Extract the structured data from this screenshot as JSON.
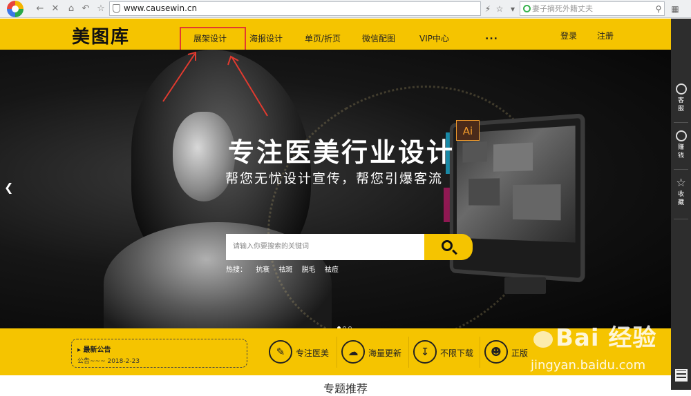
{
  "browser": {
    "url": "www.causewin.cn",
    "search_placeholder": "妻子摘死外籍丈夫"
  },
  "site": {
    "brand": "美图库",
    "nav": [
      {
        "label": "展架设计"
      },
      {
        "label": "海报设计"
      },
      {
        "label": "单页/折页"
      },
      {
        "label": "微信配图"
      },
      {
        "label": "VIP中心"
      }
    ],
    "more": "...",
    "login": "登录",
    "register": "注册"
  },
  "hero": {
    "title": "专注医美行业设计",
    "subtitle": "帮您无忧设计宣传，帮您引爆客流",
    "search_placeholder": "请输入你要搜索的关键词",
    "hot_label": "热搜：",
    "hot_terms": [
      "抗衰",
      "祛斑",
      "脱毛",
      "祛痘"
    ],
    "ai_badge": "Ai",
    "slides_total": 3,
    "slide_active": 1
  },
  "sidebar": {
    "items": [
      {
        "label": "客服",
        "icon": "headset-icon"
      },
      {
        "label": "赚钱",
        "icon": "money-bag-icon"
      },
      {
        "label": "收藏",
        "icon": "star-icon"
      }
    ]
  },
  "feature_bar": {
    "notice_title": "最新公告",
    "notice_body": "公告~~~ 2018-2-23",
    "features": [
      {
        "label": "专注医美",
        "icon": "brush-ruler-icon"
      },
      {
        "label": "海量更新",
        "icon": "cloud-icon"
      },
      {
        "label": "不限下载",
        "icon": "download-icon"
      },
      {
        "label": "正版",
        "icon": "user-icon"
      }
    ]
  },
  "section": {
    "title": "专题推荐"
  },
  "watermark": {
    "line1": "Bai 经验",
    "line2": "jingyan.baidu.com"
  },
  "colors": {
    "brand_yellow": "#f5c400",
    "annotation_red": "#e23a2f",
    "sidebar_dark": "#2d2d2d"
  }
}
